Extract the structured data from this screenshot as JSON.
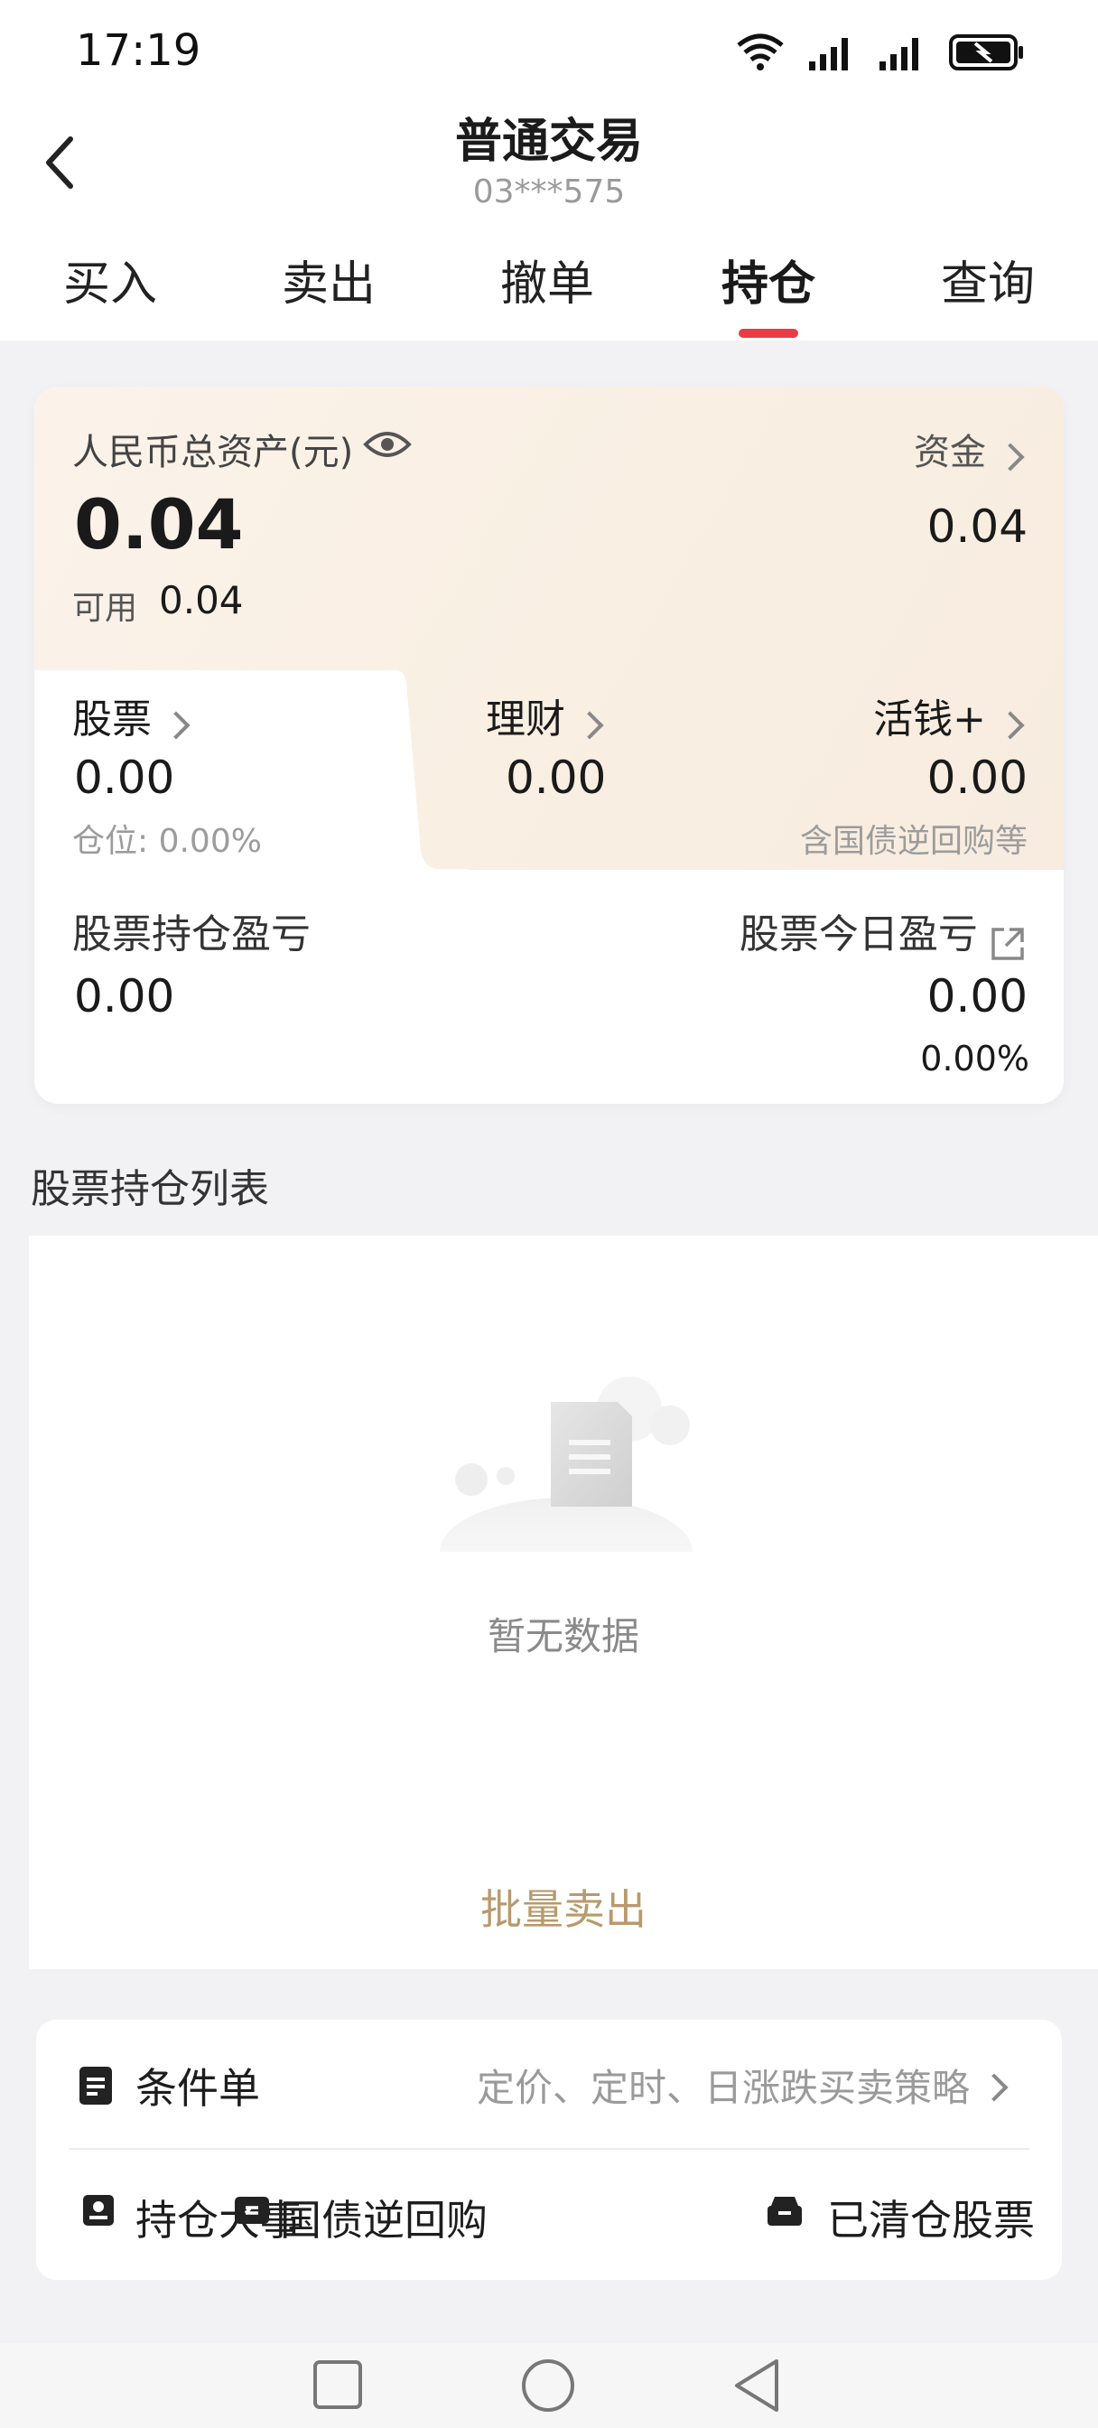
{
  "status_bar": {
    "time": "17:19"
  },
  "nav": {
    "title": "普通交易",
    "account": "03***575"
  },
  "tabs": [
    {
      "label": "买入"
    },
    {
      "label": "卖出"
    },
    {
      "label": "撤单"
    },
    {
      "label": "持仓",
      "active": true
    },
    {
      "label": "查询"
    }
  ],
  "assets": {
    "total_label": "人民币总资产(元)",
    "total_value": "0.04",
    "available_label": "可用",
    "available_value": "0.04",
    "funds_label": "资金",
    "funds_value": "0.04",
    "stock_label": "股票",
    "stock_value": "0.00",
    "position_label": "仓位: 0.00%",
    "wealth_label": "理财",
    "wealth_value": "0.00",
    "cash_label": "活钱+",
    "cash_value": "0.00",
    "cash_note": "含国债逆回购等",
    "holding_pl_label": "股票持仓盈亏",
    "holding_pl_value": "0.00",
    "today_pl_label": "股票今日盈亏",
    "today_pl_value": "0.00",
    "today_pl_pct": "0.00%"
  },
  "holdings": {
    "title": "股票持仓列表",
    "empty_text": "暂无数据",
    "batch_sell": "批量卖出"
  },
  "tools": {
    "conditional_label": "条件单",
    "conditional_desc": "定价、定时、日涨跌买卖策略",
    "events_label": "持仓大事",
    "repo_label": "国债逆回购",
    "cleared_label": "已清仓股票"
  },
  "colors": {
    "accent_red": "#ec3b47",
    "gold": "#b79a6d"
  }
}
